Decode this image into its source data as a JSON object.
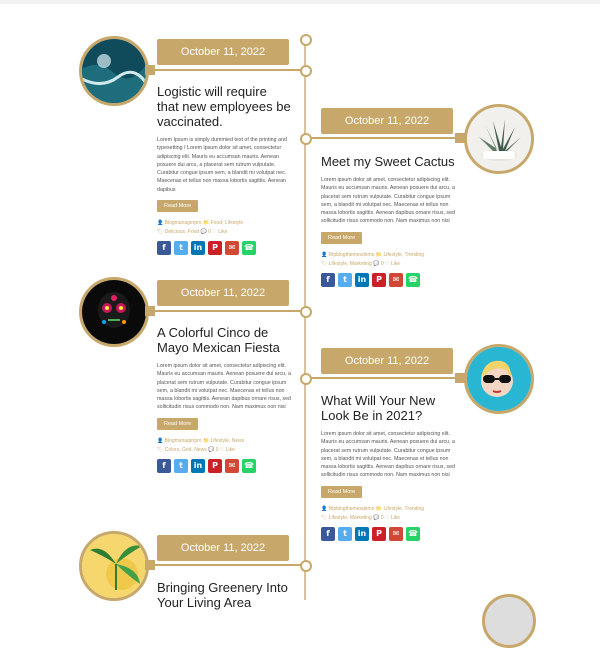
{
  "posts": [
    {
      "date": "October 11, 2022",
      "title": "Logistic will require that new employees be vaccinated.",
      "excerpt": "Lorem Ipsum is simply dummied text of the printing and typesetting I Lorem ipsum dolor sit amet, consectetur adipiscing elit. Mauris eu accumsan mauris. Aenean posuere dui arcu, a placerat sem rutrum vulputate. Curabitur congue ipsum sem, a blandit mi volutpat nec. Maecenas et tellus non massa lobortis sagittis. Aenean dapibus",
      "read_more": "Read More",
      "author": "Blogmanagerpro",
      "categories": "Food, Lifestyle",
      "tags": "Delicious, Food",
      "comments": "0",
      "likes": "Like"
    },
    {
      "date": "October 11, 2022",
      "title": "Meet my Sweet Cactus",
      "excerpt": "Lorem ipsum dolor sit amet, consectetur adipiscing elit. Mauris eu accumsan mauris. Aenean posuere dui arcu, a placerat sem rutrum vulputate. Curabitur congue ipsum sem, a blandit mi volutpat nec. Maecenas et tellus non massa lobortis sagittis. Aenean dapibus ornare risus, sed sollicitudin risus commodo non. Nam maximus non nisi",
      "read_more": "Read More",
      "author": "Wpblogthemesdemo",
      "categories": "Lifestyle, Trending",
      "tags": "Lifestyle, Marketing",
      "comments": "0",
      "likes": "Like"
    },
    {
      "date": "October 11, 2022",
      "title": "A Colorful Cinco de Mayo Mexican Fiesta",
      "excerpt": "Lorem ipsum dolor sit amet, consectetur adipiscing elit. Mauris eu accumsan mauris. Aenean posuere dui arcu, a placerat sem rutrum vulputate. Curabitur congue ipsum sem, a blandit mi volutpat nec. Maecenas et tellus non massa lobortis sagittis. Aenean dapibus ornare risus, sed sollicitudin risus commodo non. Nam maximus non nisi",
      "read_more": "Read More",
      "author": "Blogmanagerpro",
      "categories": "Lifestyle, News",
      "tags": "Colors, Grid, News",
      "comments": "0",
      "likes": "Like"
    },
    {
      "date": "October 11, 2022",
      "title": "What Will Your New Look Be in 2021?",
      "excerpt": "Lorem ipsum dolor sit amet, consectetur adipiscing elit. Mauris eu accumsan mauris. Aenean posuere dui arcu, a placerat sem rutrum vulputate. Curabitur congue ipsum sem, a blandit mi volutpat nec. Maecenas et tellus non massa lobortis sagittis. Aenean dapibus ornare risus, sed sollicitudin risus commodo non. Nam maximus non nisi",
      "read_more": "Read More",
      "author": "Wpblogthemesdemo",
      "categories": "Lifestyle, Trending",
      "tags": "Lifestyle, Marketing",
      "comments": "0",
      "likes": "Like"
    },
    {
      "date": "October 11, 2022",
      "title": "Bringing Greenery Into Your Living Area"
    }
  ],
  "share_icons": [
    "facebook-icon",
    "twitter-icon",
    "linkedin-icon",
    "pinterest-icon",
    "gmail-icon",
    "whatsapp-icon"
  ],
  "colors": {
    "accent": "#c8a86a",
    "text": "#222222"
  }
}
